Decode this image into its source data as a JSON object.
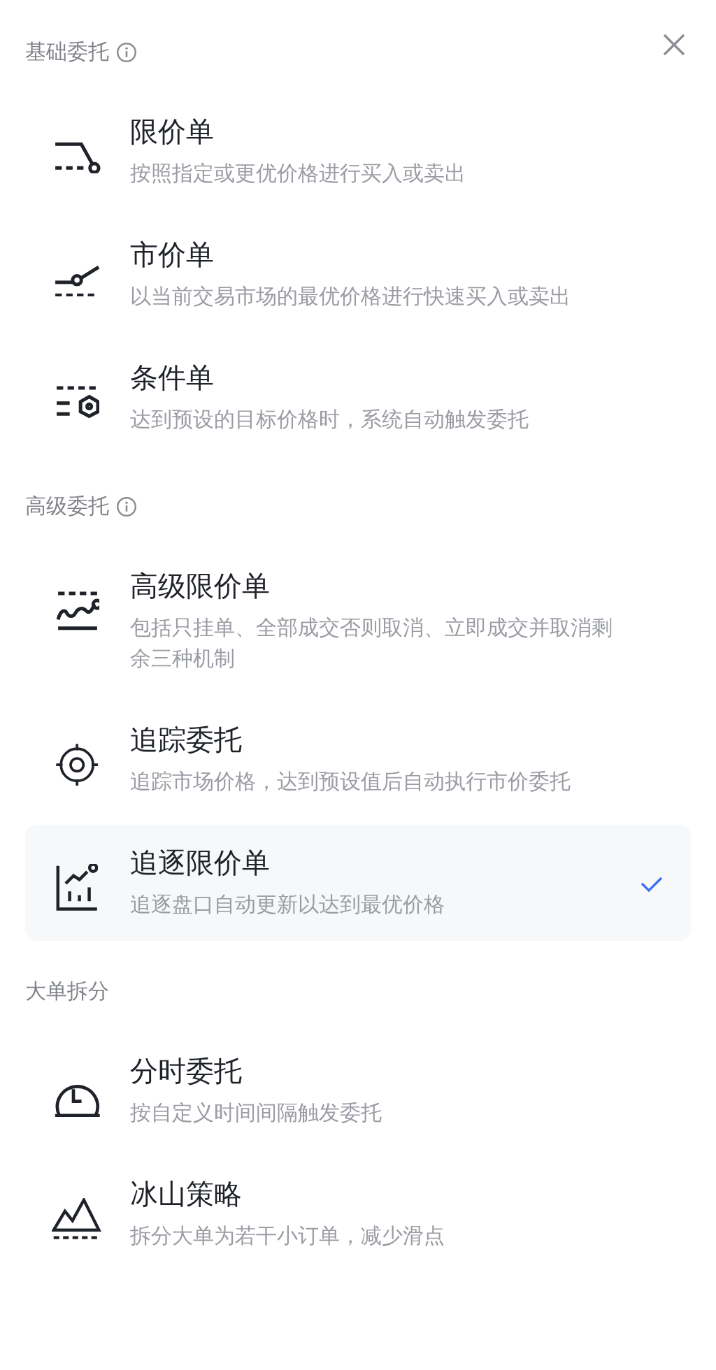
{
  "sections": [
    {
      "title": "基础委托",
      "info": true,
      "items": [
        {
          "kind": "limit",
          "title": "限价单",
          "description": "按照指定或更优价格进行买入或卖出",
          "selected": false
        },
        {
          "kind": "market",
          "title": "市价单",
          "description": "以当前交易市场的最优价格进行快速买入或卖出",
          "selected": false
        },
        {
          "kind": "conditional",
          "title": "条件单",
          "description": "达到预设的目标价格时，系统自动触发委托",
          "selected": false
        }
      ]
    },
    {
      "title": "高级委托",
      "info": true,
      "items": [
        {
          "kind": "advanced",
          "title": "高级限价单",
          "description": "包括只挂单、全部成交否则取消、立即成交并取消剩余三种机制",
          "selected": false
        },
        {
          "kind": "trailing",
          "title": "追踪委托",
          "description": "追踪市场价格，达到预设值后自动执行市价委托",
          "selected": false
        },
        {
          "kind": "chase",
          "title": "追逐限价单",
          "description": "追逐盘口自动更新以达到最优价格",
          "selected": true
        }
      ]
    },
    {
      "title": "大单拆分",
      "info": false,
      "items": [
        {
          "kind": "twap",
          "title": "分时委托",
          "description": "按自定义时间间隔触发委托",
          "selected": false
        },
        {
          "kind": "iceberg",
          "title": "冰山策略",
          "description": "拆分大单为若干小订单，减少滑点",
          "selected": false
        }
      ]
    }
  ]
}
